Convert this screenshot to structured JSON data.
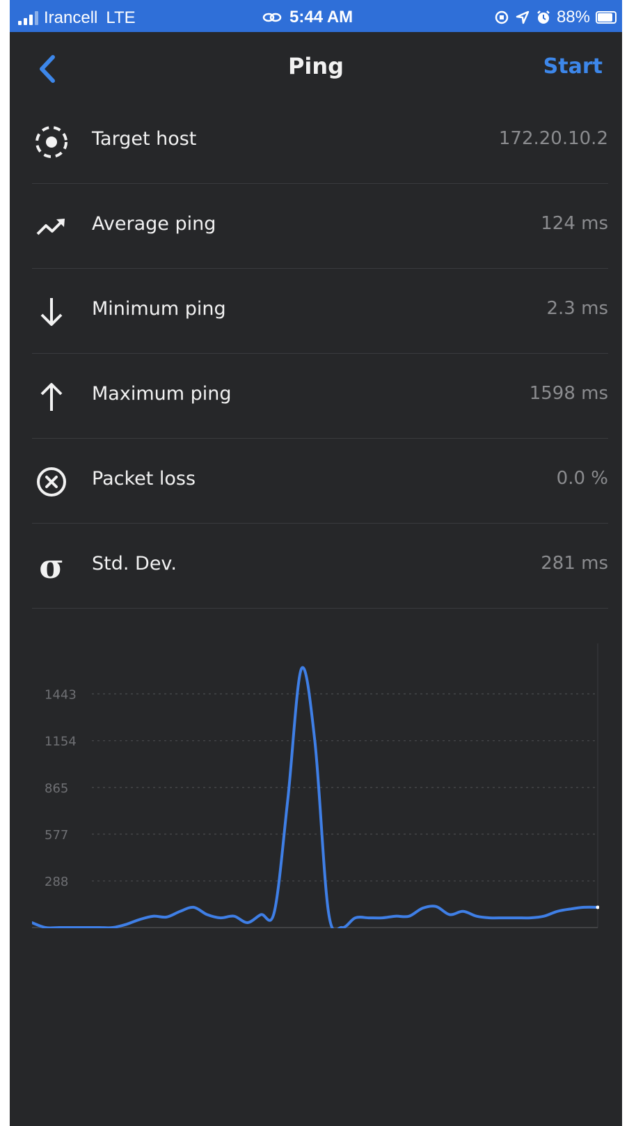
{
  "status_bar": {
    "carrier": "Irancell",
    "network": "LTE",
    "time": "5:44 AM",
    "battery": "88%",
    "battery_level": 0.88,
    "icons": [
      "signal-icon",
      "link-icon",
      "orientation-lock-icon",
      "location-icon",
      "alarm-icon",
      "battery-icon"
    ]
  },
  "nav": {
    "title": "Ping",
    "start_label": "Start",
    "back_icon": "chevron-left-icon"
  },
  "colors": {
    "accent": "#3d87ea",
    "background": "#262729",
    "status_bar": "#2f6fd8",
    "line": "#3f7fe6",
    "value_text": "#8b8c8f"
  },
  "stats": [
    {
      "icon": "target-icon",
      "label": "Target host",
      "value": "172.20.10.2"
    },
    {
      "icon": "trending-up-icon",
      "label": "Average ping",
      "value": "124 ms"
    },
    {
      "icon": "arrow-down-icon",
      "label": "Minimum ping",
      "value": "2.3 ms"
    },
    {
      "icon": "arrow-up-icon",
      "label": "Maximum ping",
      "value": "1598 ms"
    },
    {
      "icon": "circle-x-icon",
      "label": "Packet loss",
      "value": "0.0 %"
    },
    {
      "icon": "sigma-icon",
      "label": "Std. Dev.",
      "value": "281 ms",
      "symbol": "σ"
    }
  ],
  "chart_data": {
    "type": "line",
    "title": "",
    "xlabel": "",
    "ylabel": "",
    "yticks": [
      288,
      577,
      865,
      1154,
      1443
    ],
    "ylim": [
      0,
      1600
    ],
    "grid": true,
    "series": [
      {
        "values": [
          30,
          0,
          0,
          0,
          0,
          0,
          0,
          20,
          50,
          70,
          65,
          100,
          125,
          80,
          60,
          70,
          30,
          80,
          100,
          800,
          1598,
          1150,
          100,
          0,
          60,
          60,
          60,
          70,
          70,
          120,
          130,
          80,
          100,
          70,
          60,
          60,
          60,
          60,
          70,
          100,
          115,
          125,
          125
        ]
      }
    ]
  }
}
